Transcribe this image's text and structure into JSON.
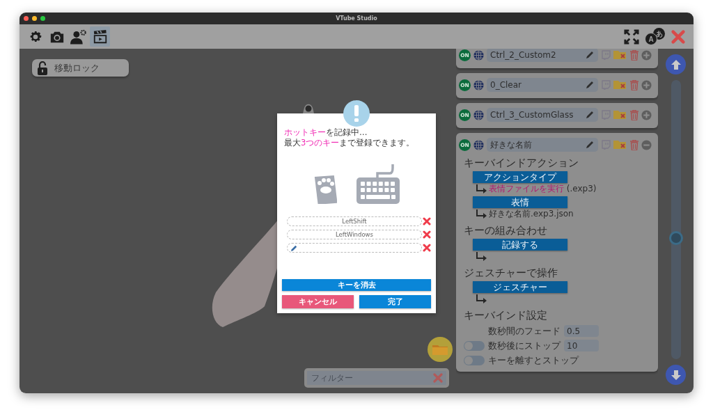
{
  "window": {
    "title": "VTube Studio"
  },
  "toolbar": {
    "tabs": [
      {
        "kind": "settings",
        "selected": false
      },
      {
        "kind": "camera",
        "selected": false
      },
      {
        "kind": "model",
        "selected": false
      },
      {
        "kind": "scene",
        "selected": true
      }
    ],
    "language_glyphs": [
      "A",
      "あ"
    ]
  },
  "move_lock": {
    "label": "移動ロック",
    "locked": false
  },
  "hotkeys": [
    {
      "badge": "ON",
      "name": "Ctrl_2_Custom2",
      "expanded": false
    },
    {
      "badge": "ON",
      "name": "0_Clear",
      "expanded": false
    },
    {
      "badge": "ON",
      "name": "Ctrl_3_CustomGlass",
      "expanded": false
    },
    {
      "badge": "ON",
      "name": "好きな名前",
      "expanded": true
    }
  ],
  "details": {
    "sections": [
      {
        "heading": "キーバインドアクション",
        "items": [
          {
            "button": "アクションタイプ",
            "value": "**表情ファイルを実行** (.exp3)"
          },
          {
            "button": "表情",
            "value": "好きな名前.exp3.json"
          }
        ]
      },
      {
        "heading": "キーの組み合わせ",
        "items": [
          {
            "button": "記録する"
          }
        ]
      },
      {
        "heading": "ジェスチャーで操作",
        "items": [
          {
            "button": "ジェスチャー"
          }
        ]
      }
    ],
    "settings_heading": "キーバインド設定",
    "settings": [
      {
        "kind": "number",
        "label": "数秒間のフェード",
        "value": "0.5"
      },
      {
        "kind": "toggle_number",
        "label": "数秒後にストップ",
        "on": false,
        "value": "10"
      },
      {
        "kind": "toggle",
        "label": "キーを離すとストップ",
        "on": false
      }
    ]
  },
  "dialog": {
    "lines": [
      "**ホットキー**を記録中…",
      "最大**3つのキー**まで登録できます。"
    ],
    "key_slots": [
      {
        "kind": "key",
        "value": "LeftShift"
      },
      {
        "kind": "key",
        "value": "LeftWindows"
      },
      {
        "kind": "recording"
      }
    ],
    "clear_button": "キーを消去",
    "cancel_button": "キャンセル",
    "done_button": "完了"
  },
  "filter": {
    "placeholder": "フィルター"
  }
}
